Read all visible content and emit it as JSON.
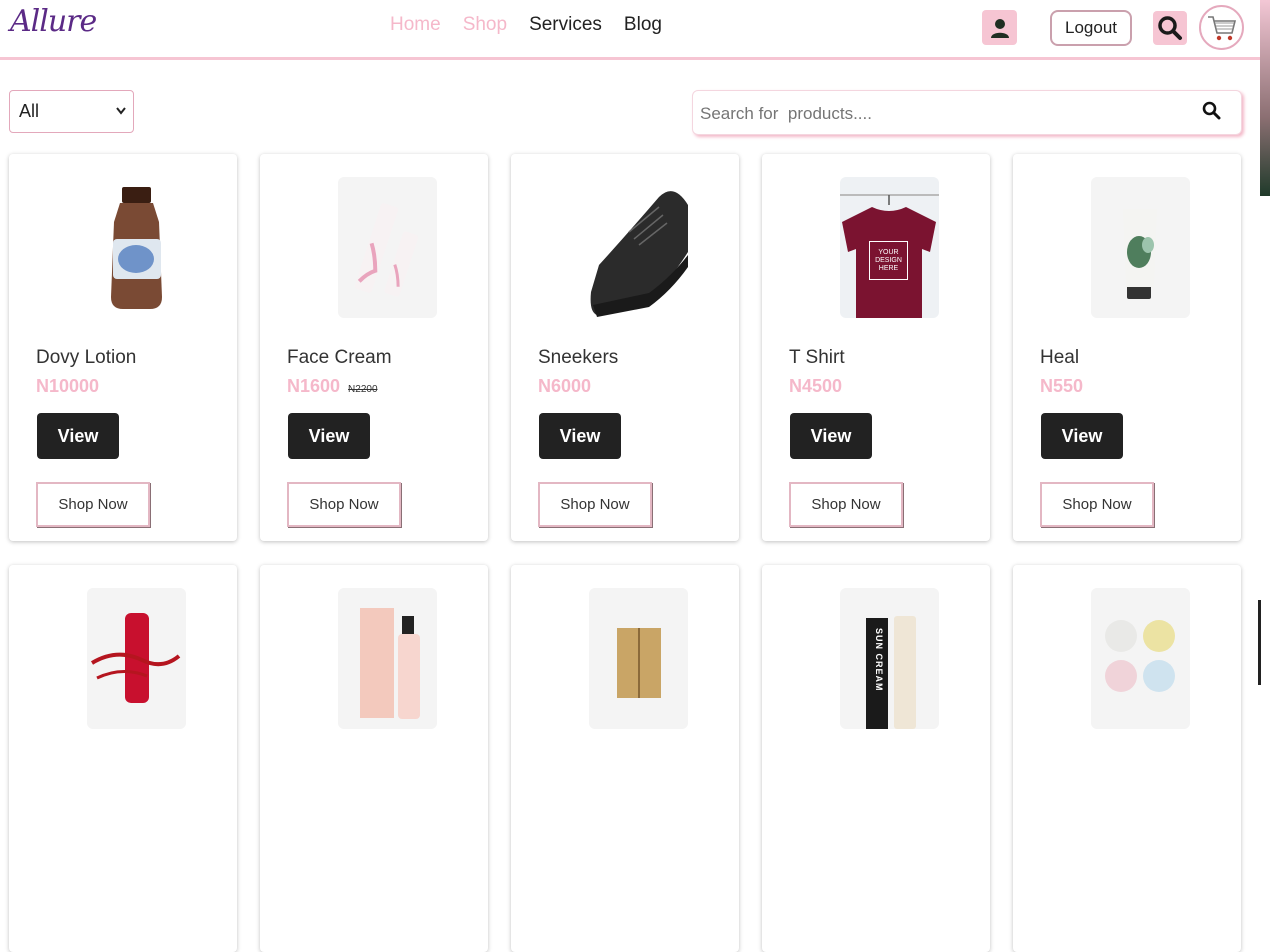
{
  "header": {
    "logo": "Allure",
    "nav": [
      {
        "label": "Home",
        "active": true
      },
      {
        "label": "Shop",
        "active": true
      },
      {
        "label": "Services",
        "active": false
      },
      {
        "label": "Blog",
        "active": false
      }
    ],
    "logout_label": "Logout",
    "icons": {
      "user": "user-icon",
      "search": "search-icon",
      "cart": "cart-icon"
    }
  },
  "filter": {
    "selected": "All"
  },
  "search": {
    "placeholder": "Search for  products...."
  },
  "products": [
    {
      "name": "Dovy Lotion",
      "price": "N10000",
      "old_price": "",
      "view": "View",
      "shop": "Shop Now"
    },
    {
      "name": "Face Cream",
      "price": "N1600",
      "old_price": "N2200",
      "view": "View",
      "shop": "Shop Now"
    },
    {
      "name": "Sneekers",
      "price": "N6000",
      "old_price": "",
      "view": "View",
      "shop": "Shop Now"
    },
    {
      "name": "T Shirt",
      "price": "N4500",
      "old_price": "",
      "view": "View",
      "shop": "Shop Now"
    },
    {
      "name": "Heal",
      "price": "N550",
      "old_price": "",
      "view": "View",
      "shop": "Shop Now"
    }
  ],
  "image_texts": {
    "tshirt": [
      "YOUR",
      "DESIGN",
      "HERE"
    ],
    "sun_cream": "SUN CREAM"
  },
  "colors": {
    "accent_pink": "#f6c5d3",
    "price_pink": "#f5b8ca",
    "logo_purple": "#5b2a86",
    "button_dark": "#222222"
  }
}
